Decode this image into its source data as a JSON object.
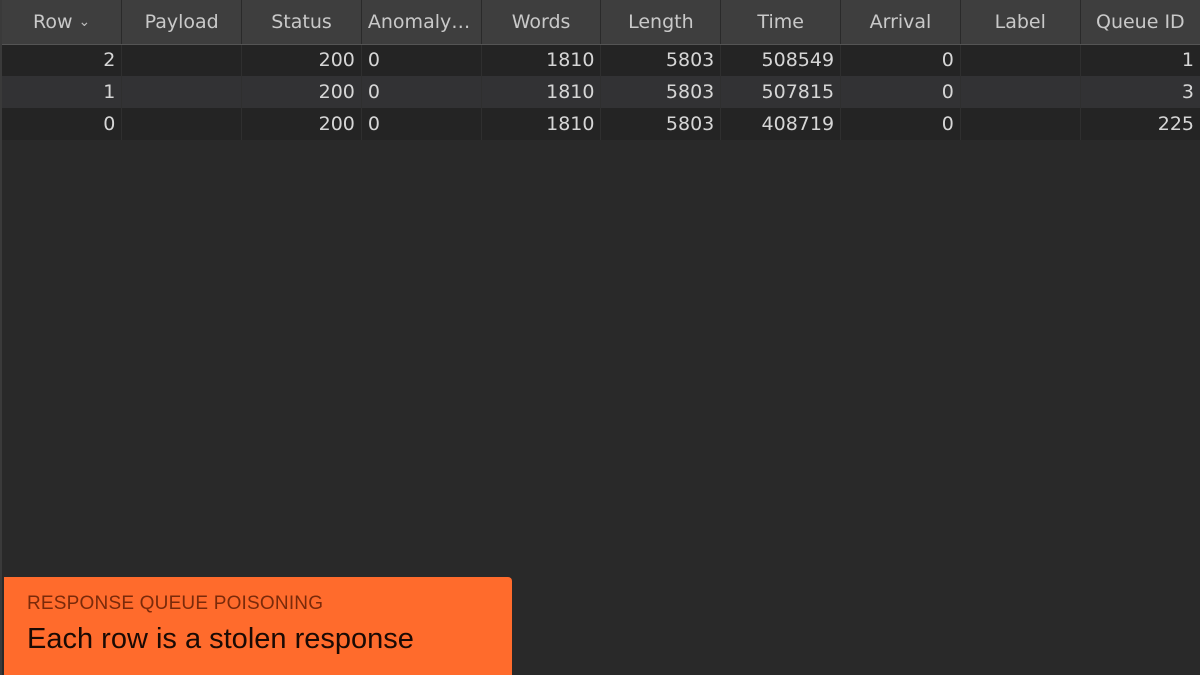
{
  "table": {
    "columns": [
      "Row",
      "Payload",
      "Status",
      "Anomaly ...",
      "Words",
      "Length",
      "Time",
      "Arrival",
      "Label",
      "Queue ID"
    ],
    "sort_icon": "chevron-down-icon",
    "rows": [
      {
        "row": "2",
        "payload": "",
        "status": "200",
        "anomaly": "0",
        "words": "1810",
        "length": "5803",
        "time": "508549",
        "arrival": "0",
        "label": "",
        "queue_id": "1"
      },
      {
        "row": "1",
        "payload": "",
        "status": "200",
        "anomaly": "0",
        "words": "1810",
        "length": "5803",
        "time": "507815",
        "arrival": "0",
        "label": "",
        "queue_id": "3"
      },
      {
        "row": "0",
        "payload": "",
        "status": "200",
        "anomaly": "0",
        "words": "1810",
        "length": "5803",
        "time": "408719",
        "arrival": "0",
        "label": "",
        "queue_id": "225"
      }
    ]
  },
  "banner": {
    "kicker": "RESPONSE QUEUE POISONING",
    "title": "Each row is a stolen response"
  },
  "colors": {
    "background": "#292929",
    "header": "#3e3e3e",
    "accent": "#ff6b2c"
  }
}
